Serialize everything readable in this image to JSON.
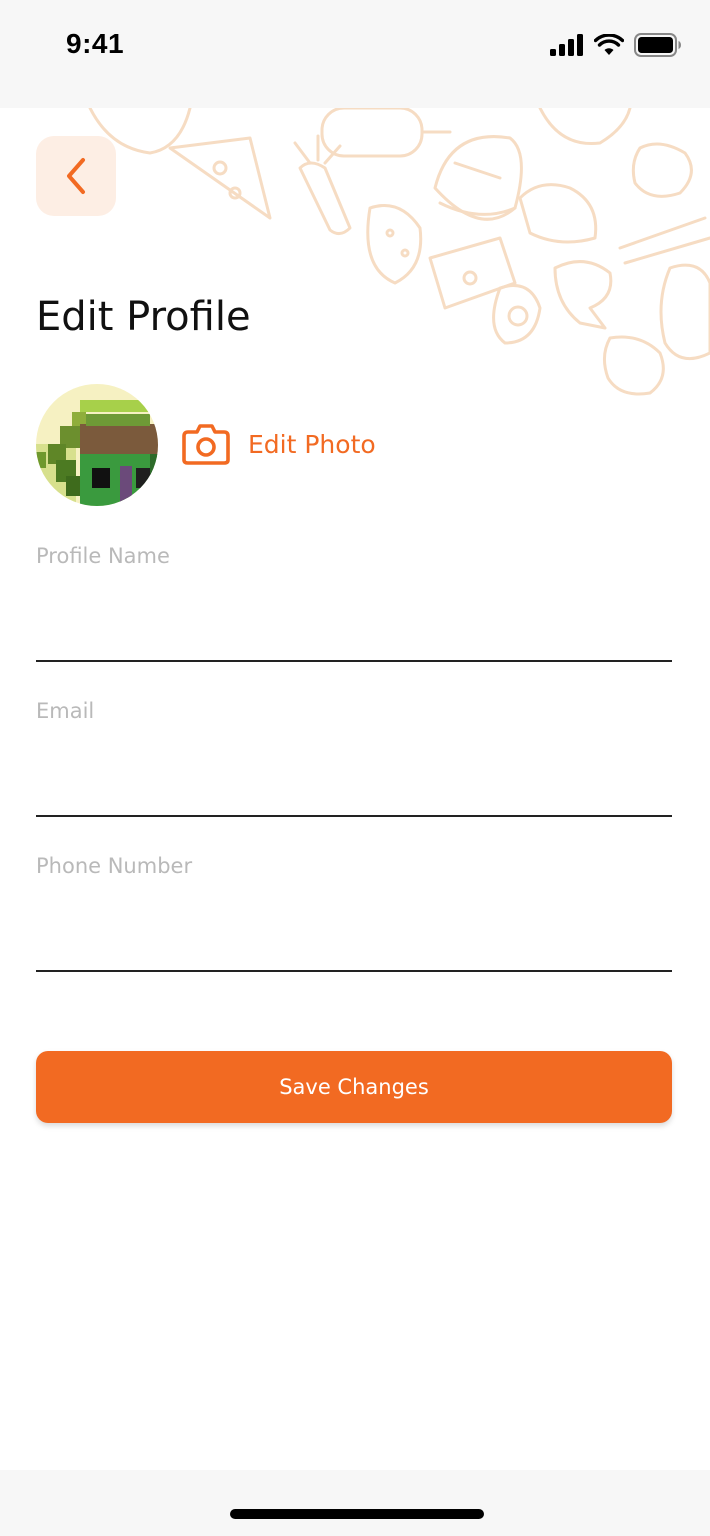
{
  "status_bar": {
    "time": "9:41",
    "icons": [
      "signal-icon",
      "wifi-icon",
      "battery-icon"
    ]
  },
  "header": {
    "back_icon": "chevron-left-icon",
    "title": "Edit Profile"
  },
  "profile_photo": {
    "edit_label": "Edit Photo",
    "edit_icon": "camera-icon"
  },
  "form": {
    "fields": [
      {
        "label": "Profile Name",
        "value": "",
        "placeholder": ""
      },
      {
        "label": "Email",
        "value": "",
        "placeholder": ""
      },
      {
        "label": "Phone Number",
        "value": "",
        "placeholder": ""
      }
    ],
    "save_label": "Save Changes"
  },
  "colors": {
    "accent": "#f26a22",
    "back_button_bg": "#fdeee4",
    "label_gray": "#b9b9b9"
  }
}
